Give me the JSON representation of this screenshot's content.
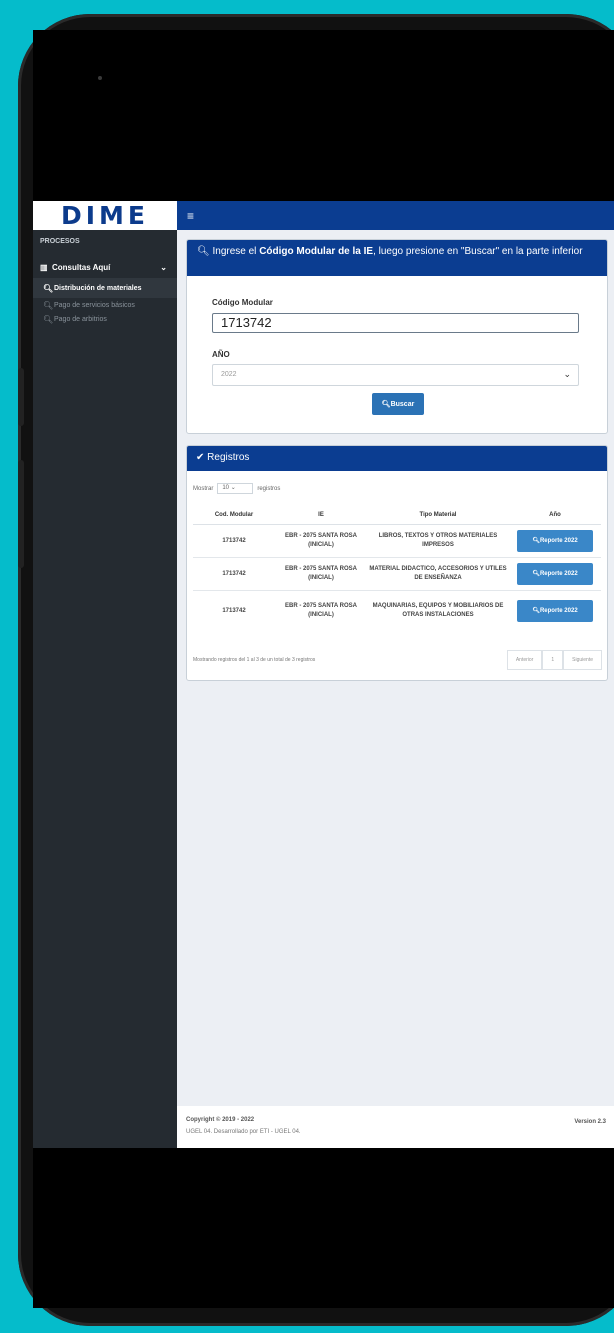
{
  "app": {
    "logo": "DIME"
  },
  "sidebar": {
    "section_title": "PROCESOS",
    "group_label": "Consultas Aquí",
    "items": [
      {
        "label": "Distribución de materiales",
        "active": true
      },
      {
        "label": "Pago de servicios básicos",
        "active": false
      },
      {
        "label": "Pago de arbitrios",
        "active": false
      }
    ]
  },
  "search_card": {
    "title_pre": "Ingrese el ",
    "title_bold": "Código Modular de la IE",
    "title_post": ", luego presione en \"Buscar\" en la parte inferior",
    "codigo_label": "Código Modular",
    "codigo_value": "1713742",
    "anio_label": "AÑO",
    "anio_value": "2022",
    "buscar_label": "Buscar"
  },
  "records_card": {
    "title": "Registros",
    "show_pre": "Mostrar",
    "show_value": "10",
    "show_post": "registros",
    "columns": [
      "Cod. Modular",
      "IE",
      "Tipo Material",
      "Año"
    ],
    "rows": [
      {
        "cod": "1713742",
        "ie": "EBR - 2075 SANTA ROSA (INICIAL)",
        "tipo": "LIBROS, TEXTOS Y OTROS MATERIALES IMPRESOS",
        "btn": "Reporte 2022"
      },
      {
        "cod": "1713742",
        "ie": "EBR - 2075 SANTA ROSA (INICIAL)",
        "tipo": "MATERIAL DIDACTICO, ACCESORIOS Y UTILES DE ENSEÑANZA",
        "btn": "Reporte 2022"
      },
      {
        "cod": "1713742",
        "ie": "EBR - 2075 SANTA ROSA (INICIAL)",
        "tipo": "MAQUINARIAS, EQUIPOS Y MOBILIARIOS DE OTRAS INSTALACIONES",
        "btn": "Reporte 2022"
      }
    ],
    "info": "Mostrando registros del 1 al 3 de un total de 3 registros",
    "prev": "Anterior",
    "page": "1",
    "next": "Siguiente"
  },
  "footer": {
    "copyright": "Copyright © 2019 - 2022",
    "dev": "UGEL 04. Desarrollado por ETI - UGEL 04.",
    "version": "Version 2.3"
  }
}
